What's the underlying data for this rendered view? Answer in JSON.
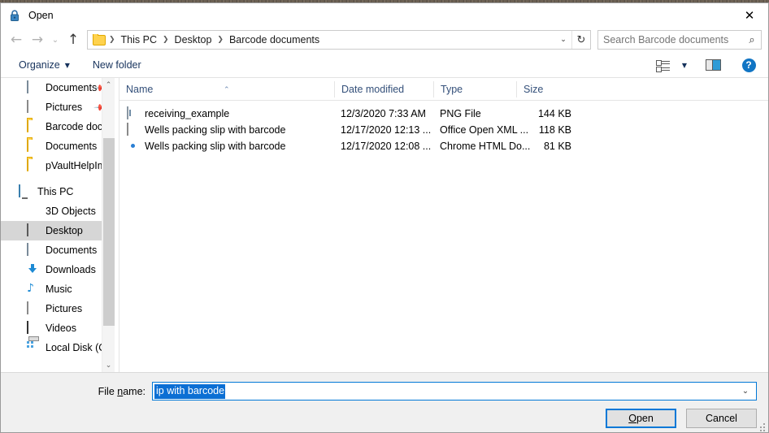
{
  "window": {
    "title": "Open",
    "title_icon": "lock-icon",
    "close_label": "✕"
  },
  "navigation": {
    "back_icon": "←",
    "forward_icon": "→",
    "recent_icon": "⌄",
    "up_icon": "↑",
    "breadcrumbs": [
      "This PC",
      "Desktop",
      "Barcode documents"
    ],
    "separator": "❯",
    "dropdown_icon": "⌄",
    "refresh_icon": "↻"
  },
  "search": {
    "placeholder": "Search Barcode documents",
    "icon": "⌕"
  },
  "toolbar": {
    "organize_label": "Organize",
    "organize_caret": "▼",
    "new_folder_label": "New folder",
    "view_caret": "▼",
    "help_label": "?"
  },
  "sidebar": {
    "items": [
      {
        "label": "Documents",
        "icon": "document-icon",
        "indent": 1,
        "pinned": true,
        "selected": false
      },
      {
        "label": "Pictures",
        "icon": "picture-icon",
        "indent": 1,
        "pinned": true,
        "selected": false
      },
      {
        "label": "Barcode documu",
        "icon": "folder-icon",
        "indent": 1,
        "pinned": false,
        "selected": false
      },
      {
        "label": "Documents",
        "icon": "folder-icon",
        "indent": 1,
        "pinned": false,
        "selected": false
      },
      {
        "label": "pVaultHelpImag",
        "icon": "folder-icon",
        "indent": 1,
        "pinned": false,
        "selected": false
      },
      {
        "label": "This PC",
        "icon": "this-pc-icon",
        "indent": 0,
        "pinned": false,
        "selected": false
      },
      {
        "label": "3D Objects",
        "icon": "3d-objects-icon",
        "indent": 1,
        "pinned": false,
        "selected": false
      },
      {
        "label": "Desktop",
        "icon": "desktop-icon",
        "indent": 1,
        "pinned": false,
        "selected": true
      },
      {
        "label": "Documents",
        "icon": "document-icon",
        "indent": 1,
        "pinned": false,
        "selected": false
      },
      {
        "label": "Downloads",
        "icon": "download-icon",
        "indent": 1,
        "pinned": false,
        "selected": false
      },
      {
        "label": "Music",
        "icon": "music-icon",
        "indent": 1,
        "pinned": false,
        "selected": false
      },
      {
        "label": "Pictures",
        "icon": "picture-icon",
        "indent": 1,
        "pinned": false,
        "selected": false
      },
      {
        "label": "Videos",
        "icon": "video-icon",
        "indent": 1,
        "pinned": false,
        "selected": false
      },
      {
        "label": "Local Disk (C:)",
        "icon": "disk-icon",
        "indent": 1,
        "pinned": false,
        "selected": false
      },
      {
        "label": "",
        "icon": "network-icon",
        "indent": 1,
        "pinned": false,
        "selected": false
      }
    ],
    "scroll_up_icon": "⌃",
    "scroll_down_icon": "⌄"
  },
  "filelist": {
    "columns": [
      "Name",
      "Date modified",
      "Type",
      "Size"
    ],
    "sort_indicator": "⌃",
    "rows": [
      {
        "name": "receiving_example",
        "icon": "png-file-icon",
        "date": "12/3/2020 7:33 AM",
        "type": "PNG File",
        "size": "144 KB"
      },
      {
        "name": "Wells packing slip with barcode",
        "icon": "xml-file-icon",
        "date": "12/17/2020 12:13 ...",
        "type": "Office Open XML ...",
        "size": "118 KB"
      },
      {
        "name": "Wells packing slip with barcode",
        "icon": "chrome-file-icon",
        "date": "12/17/2020 12:08 ...",
        "type": "Chrome HTML Do...",
        "size": "81 KB"
      }
    ]
  },
  "footer": {
    "filename_label_pre": "File ",
    "filename_label_acc": "n",
    "filename_label_post": "ame:",
    "filename_value": "ip with barcode",
    "filename_caret": "⌄",
    "open_acc": "O",
    "open_rest": "pen",
    "cancel_label": "Cancel"
  },
  "colors": {
    "accent": "#0078d7",
    "selection": "#0b6fd4",
    "header_text": "#34507a",
    "toolbar_text": "#16325c"
  }
}
